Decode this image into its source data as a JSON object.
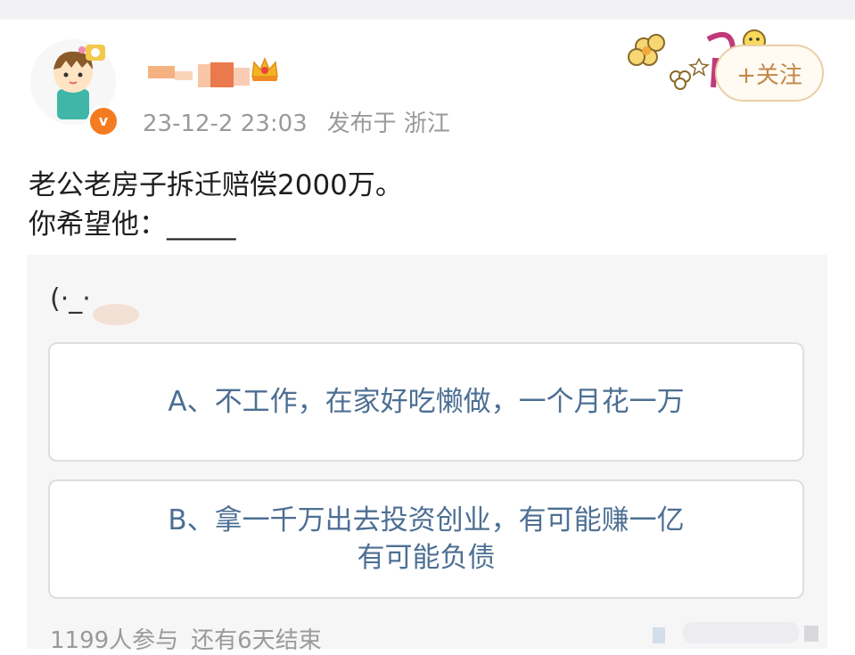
{
  "post": {
    "timestamp": "23-12-2 23:03",
    "location": "发布于 浙江",
    "text_line1": "老公老房子拆迁赔偿2000万。",
    "text_line2": "你希望他：_____",
    "follow_label": "+关注",
    "verified_badge": "v"
  },
  "poll": {
    "emoji": "(·_·",
    "options": [
      {
        "label": "A、不工作，在家好吃懒做，一个月花一万"
      },
      {
        "label": "B、拿一千万出去投资创业，有可能赚一亿有可能负债"
      }
    ],
    "participants": "1199人参与",
    "remaining": "还有6天结束"
  },
  "colors": {
    "accent_orange": "#f57b20",
    "follow_text": "#c2874a",
    "option_text": "#4d6f93",
    "meta_text": "#9a9a9a"
  },
  "icons": {
    "crown": "crown-icon",
    "verified": "verified-badge-icon",
    "decor": "sticker-decoration-icon"
  }
}
